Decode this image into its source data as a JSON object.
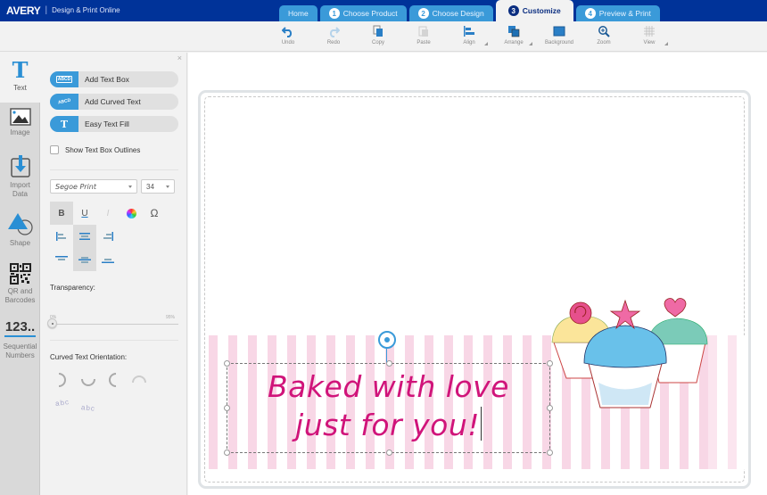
{
  "header": {
    "brand": "AVERY",
    "tagline": "Design & Print Online",
    "tabs": [
      {
        "label": "Home",
        "number": ""
      },
      {
        "label": "Choose Product",
        "number": "1"
      },
      {
        "label": "Choose Design",
        "number": "2"
      },
      {
        "label": "Customize",
        "number": "3",
        "active": true
      },
      {
        "label": "Preview & Print",
        "number": "4"
      }
    ]
  },
  "toolbar": {
    "items": [
      {
        "label": "Undo",
        "icon": "undo-icon"
      },
      {
        "label": "Redo",
        "icon": "redo-icon"
      },
      {
        "label": "Copy",
        "icon": "copy-icon"
      },
      {
        "label": "Paste",
        "icon": "paste-icon"
      },
      {
        "label": "Align",
        "icon": "align-icon"
      },
      {
        "label": "Arrange",
        "icon": "arrange-icon"
      },
      {
        "label": "Background",
        "icon": "background-icon"
      },
      {
        "label": "Zoom",
        "icon": "zoom-icon"
      },
      {
        "label": "View",
        "icon": "grid-icon"
      }
    ]
  },
  "leftnav": {
    "items": [
      {
        "label": "Text",
        "active": true
      },
      {
        "label": "Image"
      },
      {
        "label": "Import Data"
      },
      {
        "label": "Shape"
      },
      {
        "label": "QR and Barcodes"
      },
      {
        "label": "Sequential Numbers",
        "glyph": "123.."
      }
    ]
  },
  "panel": {
    "close": "×",
    "buttons": [
      {
        "label": "Add Text Box",
        "icon_text": "ABCD"
      },
      {
        "label": "Add Curved Text",
        "icon_text": "ABCD"
      },
      {
        "label": "Easy Text Fill",
        "icon_text": "T"
      }
    ],
    "show_outlines": {
      "label": "Show Text Box Outlines",
      "checked": false
    },
    "font": {
      "value": "Segoe Print",
      "size": "34"
    },
    "format": {
      "bold": "B",
      "underline": "U",
      "italic": "I",
      "special_char": "Ω",
      "bold_active": true
    },
    "alignment": {
      "horizontal": "center",
      "vertical": "middle"
    },
    "transparency": {
      "label": "Transparency:",
      "value_percent": 0,
      "min_label": "0%",
      "max_label": "95%"
    },
    "curved_orientation": {
      "label": "Curved Text Orientation:",
      "sample": "abc"
    }
  },
  "canvas": {
    "text_line1": "Baked with love",
    "text_line2": "just for you!",
    "colors": {
      "text": "#d0147a",
      "stripe": "#f8d7e6"
    }
  }
}
